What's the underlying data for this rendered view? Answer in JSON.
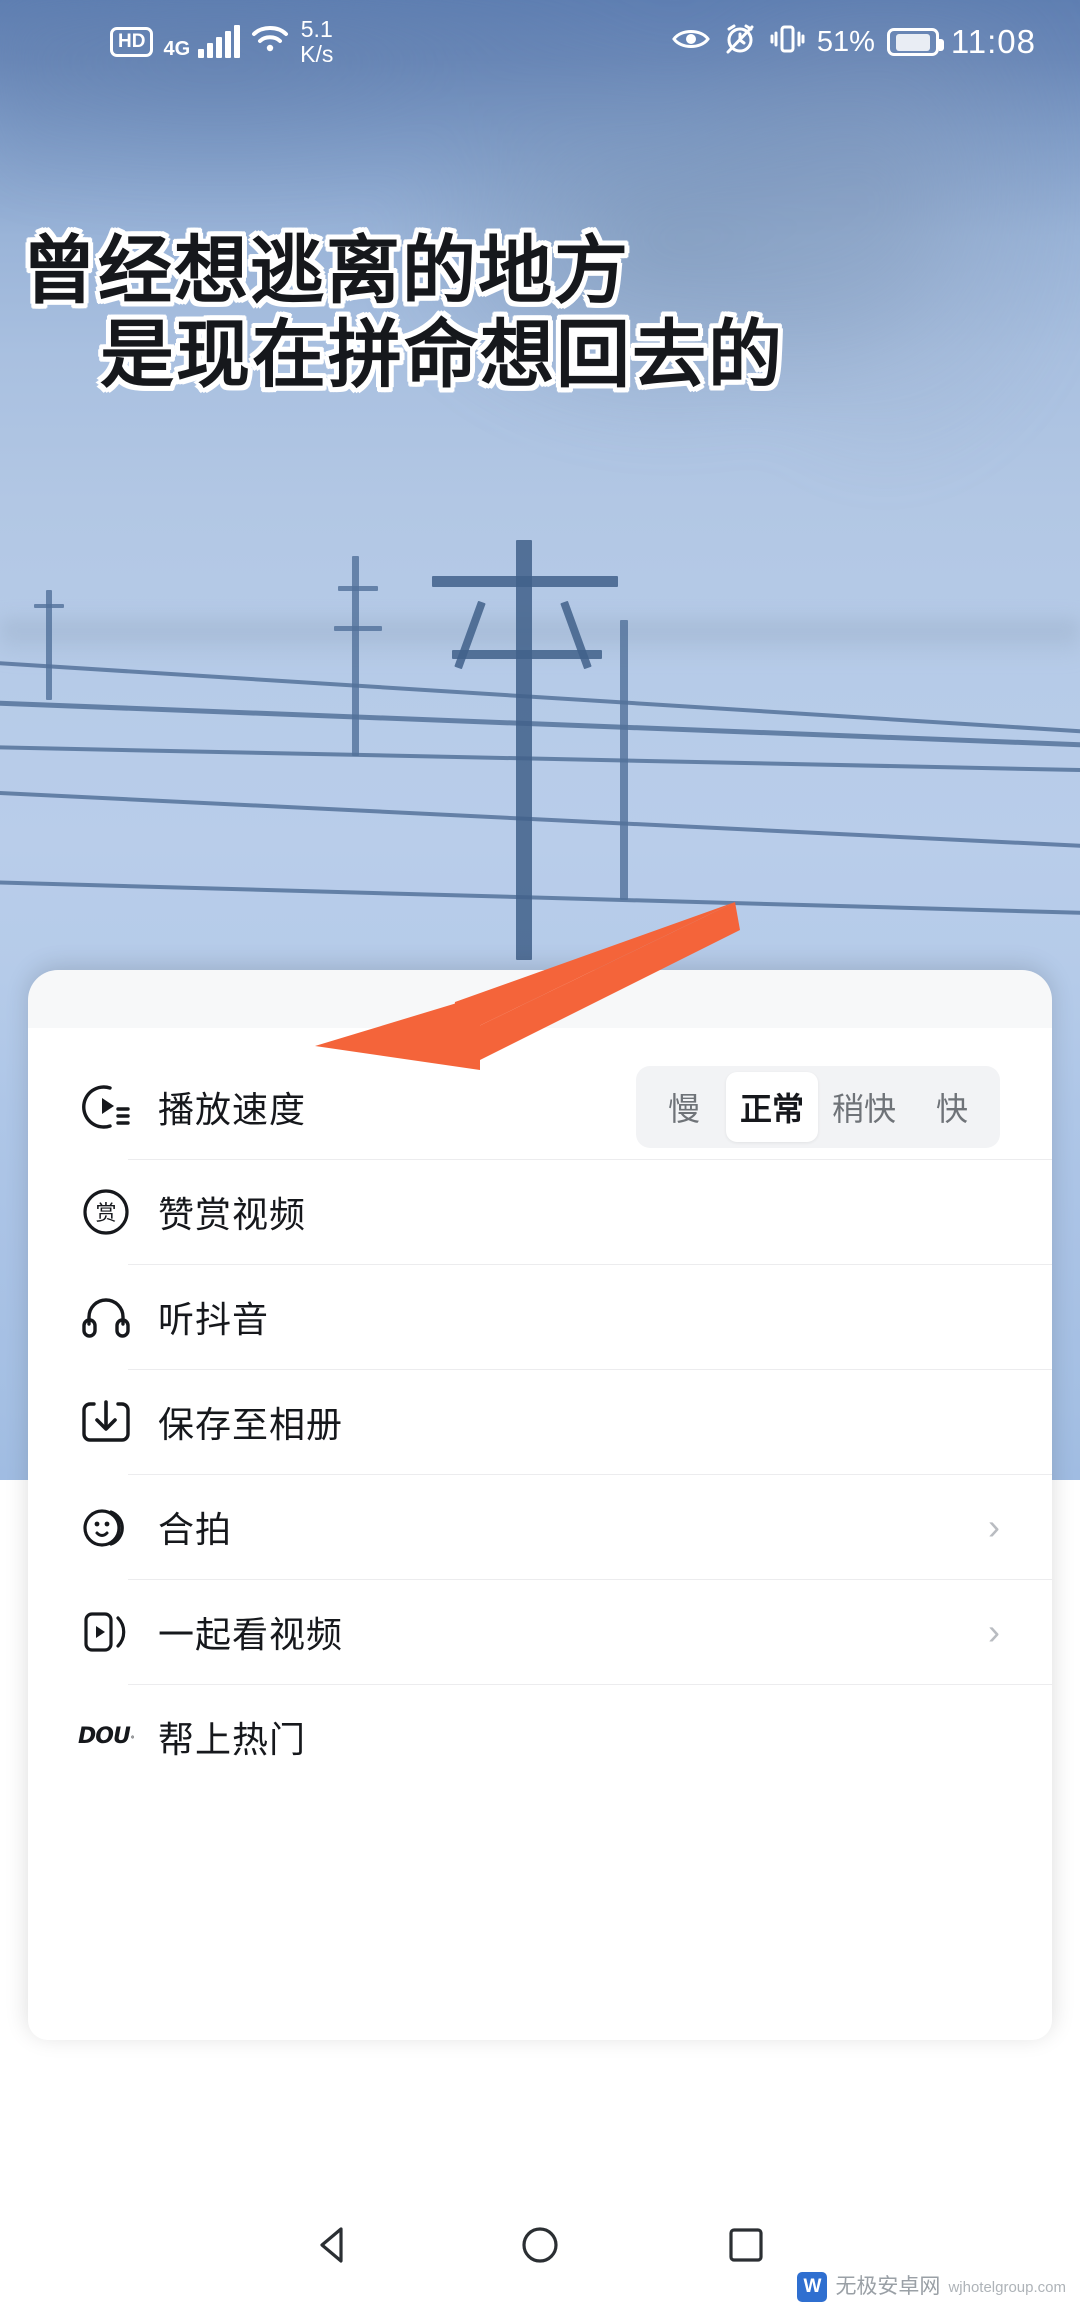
{
  "status_bar": {
    "hd_label": "HD",
    "network_type": "4G",
    "network_speed_value": "5.1",
    "network_speed_unit": "K/s",
    "battery_percent": "51%",
    "time": "11:08",
    "icons": [
      "eye-comfort-icon",
      "alarm-muted-icon",
      "vibrate-icon",
      "battery-saver-icon",
      "wifi-icon",
      "signal-bars-icon"
    ]
  },
  "video": {
    "caption_line_1": "曾经想逃离的地方",
    "caption_line_2": "是现在拼命想回去的",
    "scene_description": "blurry blue sky with power lines and utility pole"
  },
  "sheet": {
    "speed_row": {
      "icon": "playback-speed-icon",
      "label": "播放速度",
      "options": [
        "慢",
        "正常",
        "稍快",
        "快"
      ],
      "selected": "正常"
    },
    "items": [
      {
        "icon": "reward-icon",
        "label": "赞赏视频",
        "chevron": false
      },
      {
        "icon": "headphones-icon",
        "label": "听抖音",
        "chevron": false
      },
      {
        "icon": "download-icon",
        "label": "保存至相册",
        "chevron": false
      },
      {
        "icon": "duet-face-icon",
        "label": "合拍",
        "chevron": true
      },
      {
        "icon": "watch-together-icon",
        "label": "一起看视频",
        "chevron": true
      },
      {
        "icon": "dou-plus-icon",
        "label": "帮上热门",
        "chevron": false
      }
    ],
    "chevron_glyph": "›",
    "dou_icon_text": "DOU"
  },
  "annotation": {
    "arrow_color": "#F4643A",
    "points_to": "保存至相册"
  },
  "navbar": {
    "back_label": "back-triangle-icon",
    "home_label": "home-circle-icon",
    "recents_label": "recents-square-icon"
  },
  "watermark": {
    "logo_text": "W",
    "text": "无极安卓网",
    "sub": "wjhotelgroup.com"
  },
  "colors": {
    "accent_orange": "#F4643A",
    "sheet_bg": "#F7F8F9",
    "text_primary": "#16181C",
    "text_muted": "#6F7378",
    "divider": "#ECECEE"
  }
}
